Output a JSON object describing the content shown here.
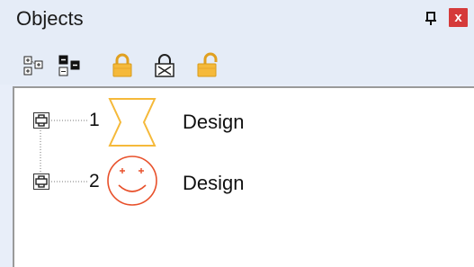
{
  "panel": {
    "title": "Objects",
    "pin_glyph": "ᵖ",
    "close_glyph": "x"
  },
  "toolbar": {
    "buttons": [
      {
        "name": "expand-all-icon"
      },
      {
        "name": "collapse-all-icon"
      },
      {
        "name": "lock-icon"
      },
      {
        "name": "lock-delete-icon"
      },
      {
        "name": "unlock-icon"
      }
    ]
  },
  "tree": {
    "nodes": [
      {
        "number": "1",
        "label": "Design",
        "thumbnail": "hourglass-shape"
      },
      {
        "number": "2",
        "label": "Design",
        "thumbnail": "smiley-face"
      }
    ]
  },
  "colors": {
    "accent_orange": "#f5b93a",
    "smiley_red": "#e8502a",
    "close_red": "#d53a3a"
  }
}
